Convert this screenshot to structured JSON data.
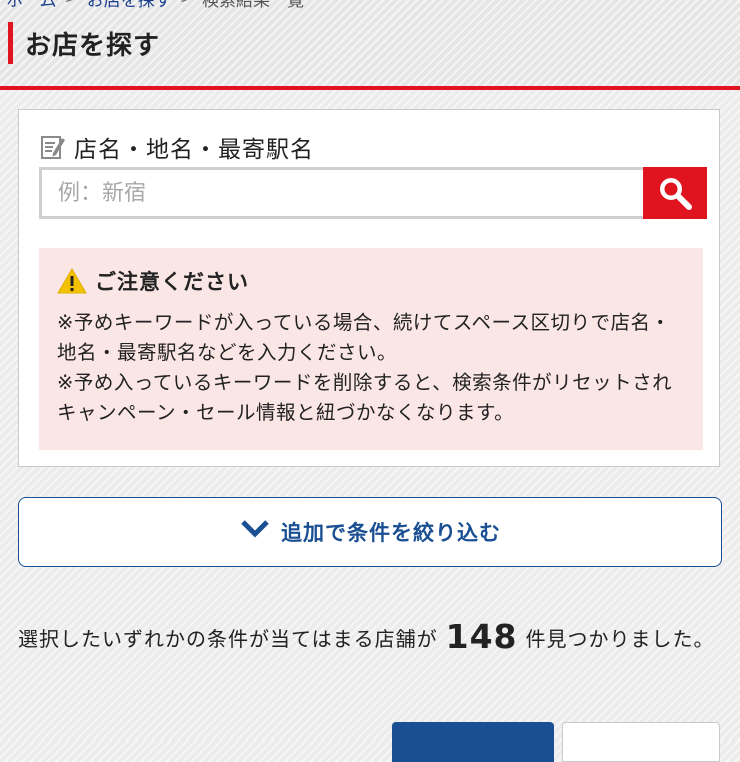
{
  "breadcrumb": {
    "items": [
      "ホーム",
      "お店を探す",
      "検索結果一覧"
    ],
    "separator": ">"
  },
  "header": {
    "title": "お店を探す",
    "accent_color": "#e0141e"
  },
  "search": {
    "label": "店名・地名・最寄駅名",
    "placeholder": "例：新宿",
    "value": "",
    "button_icon": "search-icon"
  },
  "notice": {
    "title": "ご注意ください",
    "lines": [
      "※予めキーワードが入っている場合、続けてスペース区切りで店名・地名・最寄駅名などを入力ください。",
      "※予め入っているキーワードを削除すると、検索条件がリセットされキャンペーン・セール情報と紐づかなくなります。"
    ]
  },
  "filter": {
    "label": "追加で条件を絞り込む",
    "icon": "chevron-down-icon",
    "color": "#1a4f93"
  },
  "results": {
    "prefix": "選択したいずれかの条件が当てはまる店舗が",
    "count": "148",
    "suffix": "件見つかりました。"
  }
}
